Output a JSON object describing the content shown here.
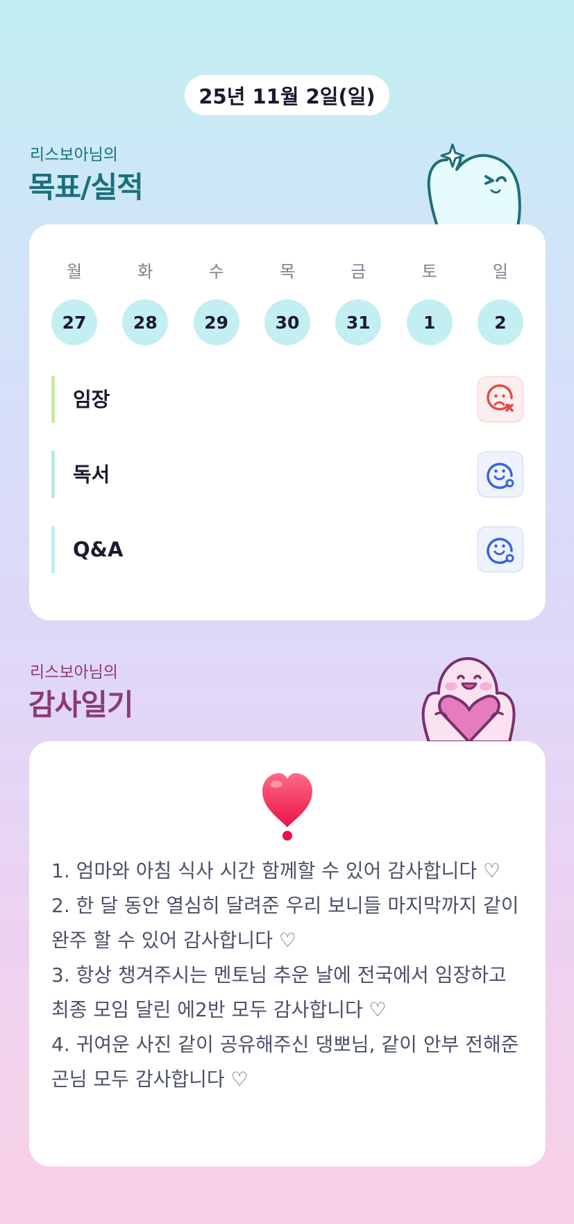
{
  "header": {
    "date": "25년 11월 2일(일)"
  },
  "goals_section": {
    "subtitle": "리스보아님의",
    "title": "목표/실적",
    "weekdays": [
      "월",
      "화",
      "수",
      "목",
      "금",
      "토",
      "일"
    ],
    "dates": [
      "27",
      "28",
      "29",
      "30",
      "31",
      "1",
      "2"
    ],
    "goals": [
      {
        "label": "임장",
        "status": "fail",
        "bar_color": "#c7ec9f",
        "icon": "sad-x-face-icon"
      },
      {
        "label": "독서",
        "status": "done",
        "bar_color": "#b6ecd5",
        "icon": "smile-check-face-icon"
      },
      {
        "label": "Q&A",
        "status": "done",
        "bar_color": "#bdeef3",
        "icon": "smile-check-face-icon"
      }
    ]
  },
  "gratitude_section": {
    "subtitle": "리스보아님의",
    "title": "감사일기",
    "icon": "heart-exclamation-icon",
    "text": "1. 엄마와 아침 식사 시간 함께할 수 있어 감사합니다 ♡\n2. 한 달 동안 열심히 달려준 우리 보니들 마지막까지 같이 완주 할 수 있어 감사합니다 ♡\n3. 항상 챙겨주시는 멘토님 추운 날에 전국에서 임장하고 최종 모임 달린 에2반 모두 감사합니다 ♡\n4. 귀여운 사진 같이 공유해주신 댕뽀님, 같이 안부 전해준 곤님 모두 감사합니다 ♡"
  },
  "colors": {
    "teal_title": "#1b6f7c",
    "plum_title": "#8a3b78",
    "date_circle": "#c3eef2",
    "fail_red": "#e34a4a",
    "ok_blue": "#3a63e0"
  }
}
